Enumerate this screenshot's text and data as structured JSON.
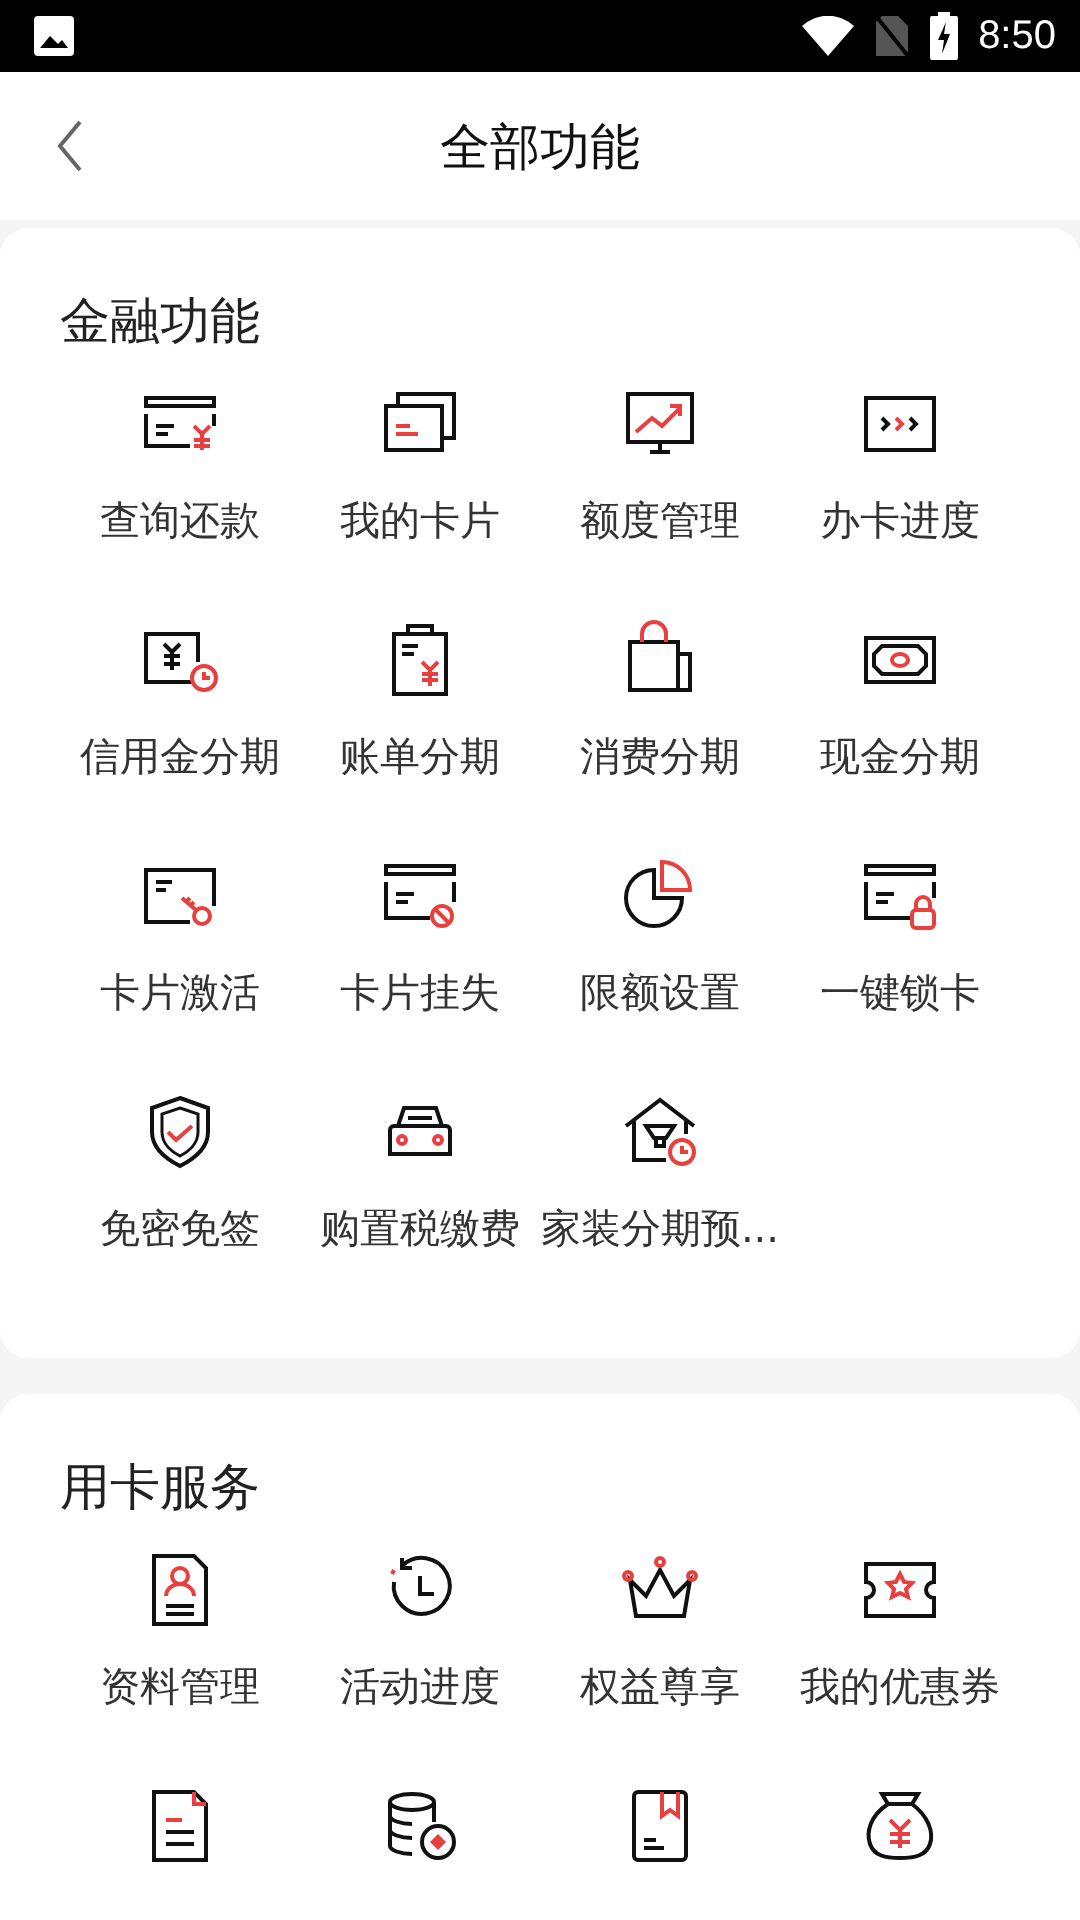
{
  "status_bar": {
    "time": "8:50"
  },
  "header": {
    "title": "全部功能"
  },
  "sections": [
    {
      "title": "金融功能",
      "items": [
        {
          "kind": "labeled",
          "label": "查询还款"
        },
        {
          "kind": "labeled",
          "label": "我的卡片"
        },
        {
          "kind": "labeled",
          "label": "额度管理"
        },
        {
          "kind": "labeled",
          "label": "办卡进度"
        },
        {
          "kind": "labeled",
          "label": "信用金分期"
        },
        {
          "kind": "labeled",
          "label": "账单分期"
        },
        {
          "kind": "labeled",
          "label": "消费分期"
        },
        {
          "kind": "labeled",
          "label": "现金分期"
        },
        {
          "kind": "labeled",
          "label": "卡片激活"
        },
        {
          "kind": "labeled",
          "label": "卡片挂失"
        },
        {
          "kind": "labeled",
          "label": "限额设置"
        },
        {
          "kind": "labeled",
          "label": "一键锁卡"
        },
        {
          "kind": "labeled",
          "label": "免密免签"
        },
        {
          "kind": "labeled",
          "label": "购置税缴费"
        },
        {
          "kind": "labeled",
          "label": "家装分期预..."
        }
      ]
    },
    {
      "title": "用卡服务",
      "items": [
        {
          "kind": "labeled",
          "label": "资料管理"
        },
        {
          "kind": "labeled",
          "label": "活动进度"
        },
        {
          "kind": "labeled",
          "label": "权益尊享"
        },
        {
          "kind": "labeled",
          "label": "我的优惠券"
        },
        {
          "kind": "icon"
        },
        {
          "kind": "icon"
        },
        {
          "kind": "icon"
        },
        {
          "kind": "icon"
        }
      ]
    }
  ]
}
